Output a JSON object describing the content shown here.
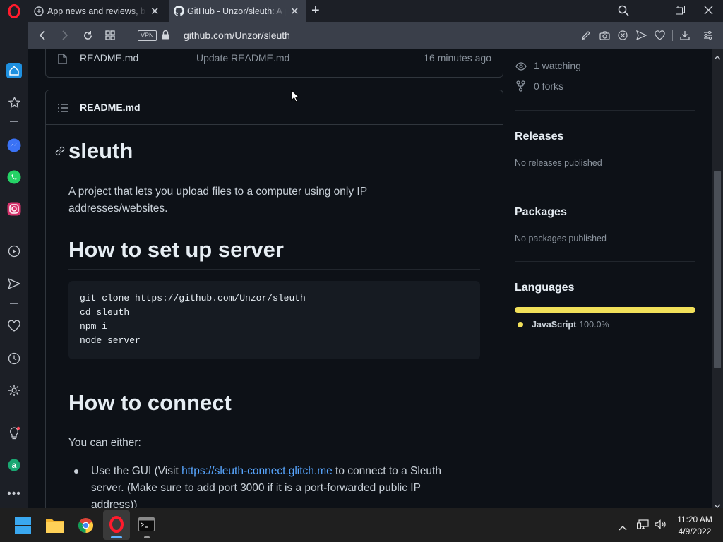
{
  "browser": {
    "tabs": [
      {
        "label": "App news and reviews, best",
        "icon": "news-icon"
      },
      {
        "label": "GitHub - Unzor/sleuth: A project",
        "icon": "github-icon"
      }
    ],
    "url": "github.com/Unzor/sleuth",
    "vpn_label": "VPN"
  },
  "repo": {
    "file_row": {
      "name": "README.md",
      "commit": "Update README.md",
      "time": "16 minutes ago"
    },
    "readme_header": "README.md",
    "readme": {
      "title": "sleuth",
      "intro": "A project that lets you upload files to a computer using only IP addresses/websites.",
      "setup_heading": "How to set up server",
      "code_lines": [
        "git clone https://github.com/Unzor/sleuth",
        "cd sleuth",
        "npm i",
        "node server"
      ],
      "connect_heading": "How to connect",
      "either": "You can either:",
      "bullet_prefix": "Use the GUI (Visit ",
      "bullet_link": "https://sleuth-connect.glitch.me",
      "bullet_suffix": " to connect to a Sleuth server. (Make sure to add port 3000 if it is a port-forwarded public IP address))"
    }
  },
  "sidebar_right": {
    "watching": "1 watching",
    "forks": "0 forks",
    "releases_heading": "Releases",
    "releases_text": "No releases published",
    "packages_heading": "Packages",
    "packages_text": "No packages published",
    "languages_heading": "Languages",
    "language_name": "JavaScript",
    "language_pct": "100.0%",
    "language_color": "#f1e05a"
  },
  "taskbar": {
    "time": "11:20 AM",
    "date": "4/9/2022"
  }
}
